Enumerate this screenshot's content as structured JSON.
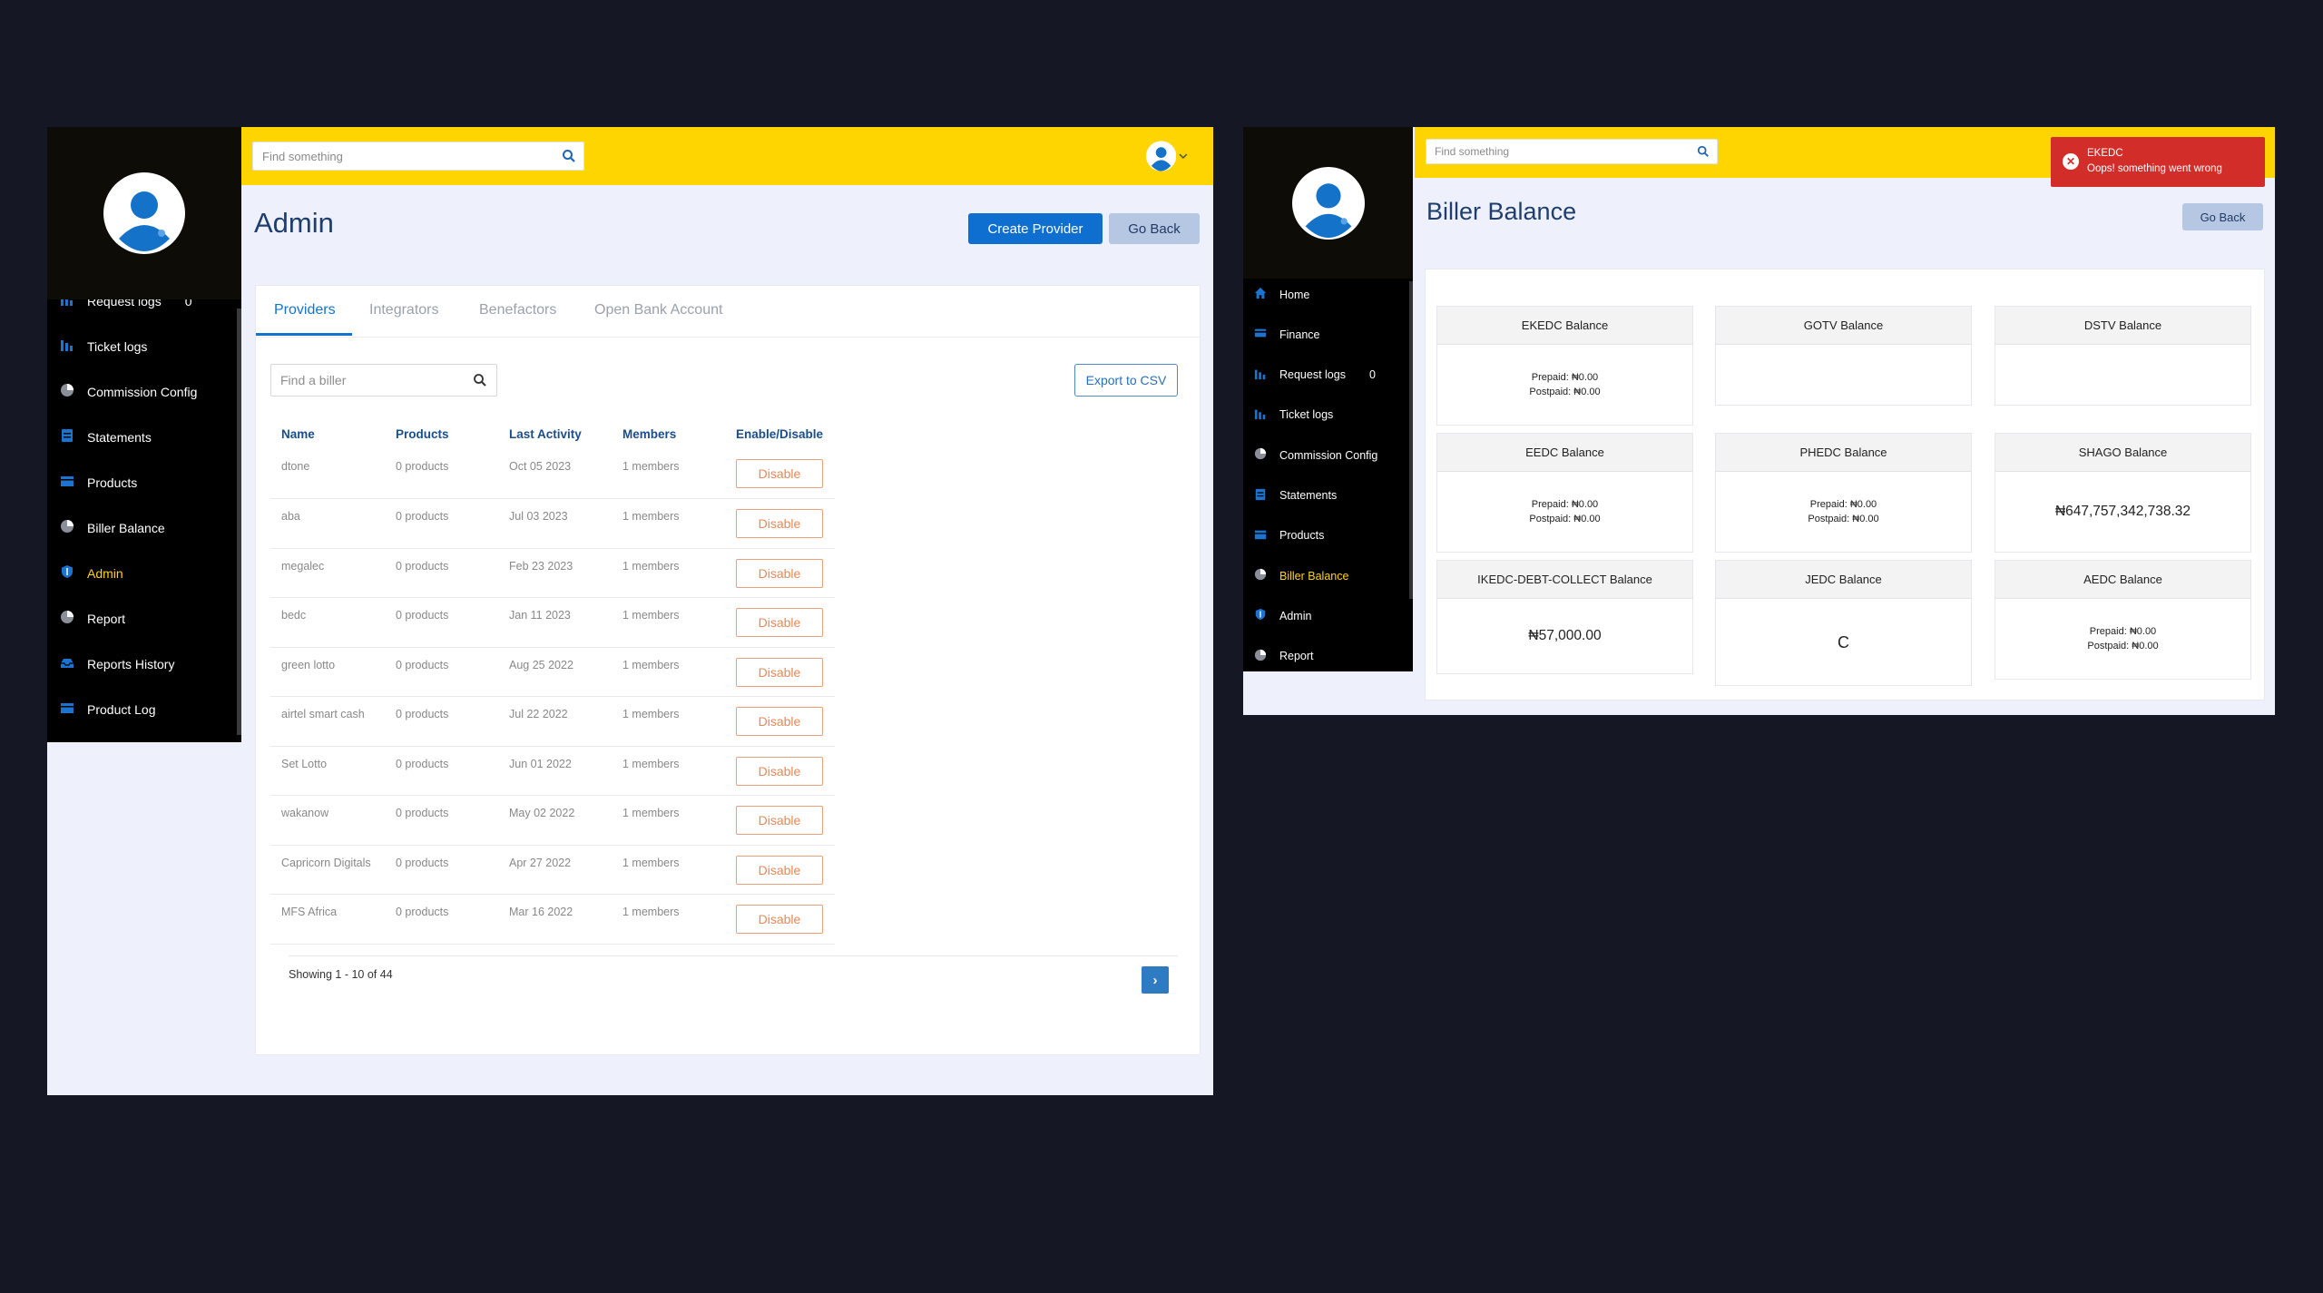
{
  "left": {
    "search_placeholder": "Find something",
    "page_title": "Admin",
    "create_provider_label": "Create Provider",
    "go_back_label": "Go Back",
    "nav": [
      {
        "label": "Request logs",
        "icon": "bar-chart-icon",
        "count": "0"
      },
      {
        "label": "Ticket logs",
        "icon": "bar-chart-icon"
      },
      {
        "label": "Commission Config",
        "icon": "pie-chart-icon"
      },
      {
        "label": "Statements",
        "icon": "document-icon"
      },
      {
        "label": "Products",
        "icon": "box-icon"
      },
      {
        "label": "Biller Balance",
        "icon": "pie-chart-icon"
      },
      {
        "label": "Admin",
        "icon": "shield-icon",
        "active": true
      },
      {
        "label": "Report",
        "icon": "pie-chart-icon"
      },
      {
        "label": "Reports History",
        "icon": "tray-icon"
      },
      {
        "label": "Product Log",
        "icon": "box-icon"
      }
    ],
    "tabs": [
      "Providers",
      "Integrators",
      "Benefactors",
      "Open Bank Account"
    ],
    "biller_search_placeholder": "Find a biller",
    "export_label": "Export to CSV",
    "columns": [
      "Name",
      "Products",
      "Last Activity",
      "Members",
      "Enable/Disable"
    ],
    "rows": [
      {
        "name": "dtone",
        "products": "0 products",
        "last_activity": "Oct 05 2023",
        "members": "1 members",
        "action": "Disable"
      },
      {
        "name": "aba",
        "products": "0 products",
        "last_activity": "Jul 03 2023",
        "members": "1 members",
        "action": "Disable"
      },
      {
        "name": "megalec",
        "products": "0 products",
        "last_activity": "Feb 23 2023",
        "members": "1 members",
        "action": "Disable"
      },
      {
        "name": "bedc",
        "products": "0 products",
        "last_activity": "Jan 11 2023",
        "members": "1 members",
        "action": "Disable"
      },
      {
        "name": "green lotto",
        "products": "0 products",
        "last_activity": "Aug 25 2022",
        "members": "1 members",
        "action": "Disable"
      },
      {
        "name": "airtel smart cash",
        "products": "0 products",
        "last_activity": "Jul 22 2022",
        "members": "1 members",
        "action": "Disable"
      },
      {
        "name": "Set Lotto",
        "products": "0 products",
        "last_activity": "Jun 01 2022",
        "members": "1 members",
        "action": "Disable"
      },
      {
        "name": "wakanow",
        "products": "0 products",
        "last_activity": "May 02 2022",
        "members": "1 members",
        "action": "Disable"
      },
      {
        "name": "Capricorn Digitals",
        "products": "0 products",
        "last_activity": "Apr 27 2022",
        "members": "1 members",
        "action": "Disable"
      },
      {
        "name": "MFS Africa",
        "products": "0 products",
        "last_activity": "Mar 16 2022",
        "members": "1 members",
        "action": "Disable"
      }
    ],
    "pager_text": "Showing 1 - 10 of 44",
    "pager_next": "›"
  },
  "right": {
    "search_placeholder": "Find something",
    "page_title": "Biller Balance",
    "go_back_label": "Go Back",
    "nav": [
      {
        "label": "Home",
        "icon": "home-icon"
      },
      {
        "label": "Finance",
        "icon": "card-icon"
      },
      {
        "label": "Request logs",
        "icon": "bar-chart-icon",
        "count": "0"
      },
      {
        "label": "Ticket logs",
        "icon": "bar-chart-icon"
      },
      {
        "label": "Commission Config",
        "icon": "pie-chart-icon"
      },
      {
        "label": "Statements",
        "icon": "document-icon"
      },
      {
        "label": "Products",
        "icon": "box-icon"
      },
      {
        "label": "Biller Balance",
        "icon": "pie-chart-icon",
        "active": true
      },
      {
        "label": "Admin",
        "icon": "shield-icon"
      },
      {
        "label": "Report",
        "icon": "pie-chart-icon"
      }
    ],
    "balances": [
      {
        "title": "EKEDC Balance",
        "lines": [
          "Prepaid: ₦0.00",
          "Postpaid: ₦0.00"
        ],
        "style": "small"
      },
      {
        "title": "GOTV Balance",
        "lines": [],
        "style": "small"
      },
      {
        "title": "DSTV Balance",
        "lines": [],
        "style": "small"
      },
      {
        "title": "EEDC Balance",
        "lines": [
          "Prepaid: ₦0.00",
          "Postpaid: ₦0.00"
        ],
        "style": "small"
      },
      {
        "title": "PHEDC Balance",
        "lines": [
          "Prepaid: ₦0.00",
          "Postpaid: ₦0.00"
        ],
        "style": "small"
      },
      {
        "title": "SHAGO Balance",
        "lines": [
          "₦647,757,342,738.32"
        ],
        "style": "big"
      },
      {
        "title": "IKEDC-DEBT-COLLECT Balance",
        "lines": [
          "₦57,000.00"
        ],
        "style": "big"
      },
      {
        "title": "JEDC Balance",
        "lines": [
          "C"
        ],
        "style": "huge"
      },
      {
        "title": "AEDC Balance",
        "lines": [
          "Prepaid: ₦0.00",
          "Postpaid: ₦0.00"
        ],
        "style": "small"
      }
    ],
    "toast": {
      "title": "EKEDC",
      "message": "Oops! something went wrong",
      "close": "✕"
    }
  },
  "colors": {
    "background": "#161725",
    "topbar": "#ffd500",
    "primary": "#0f6fd1",
    "active_nav": "#ffd21a",
    "disable_outline": "#e7a17a",
    "toast": "#d32d2a"
  }
}
